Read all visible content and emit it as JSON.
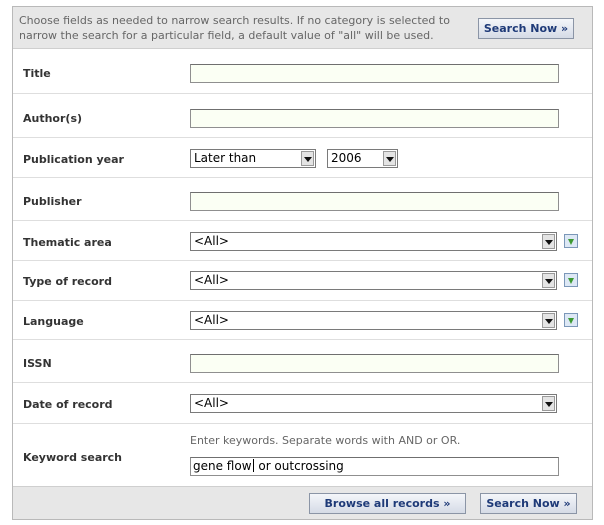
{
  "info_text": "Choose fields as needed to narrow search results. If no category is selected to narrow the search for a particular field, a default value of \"all\" will be used.",
  "buttons": {
    "search_now": "Search Now »",
    "browse_all": "Browse all records »"
  },
  "fields": {
    "title": {
      "label": "Title",
      "value": ""
    },
    "authors": {
      "label": "Author(s)",
      "value": ""
    },
    "publication_year": {
      "label": "Publication year",
      "qualifier": "Later than",
      "year": "2006"
    },
    "publisher": {
      "label": "Publisher",
      "value": ""
    },
    "thematic_area": {
      "label": "Thematic area",
      "selected": "<All>"
    },
    "type_of_record": {
      "label": "Type of record",
      "selected": "<All>"
    },
    "language": {
      "label": "Language",
      "selected": "<All>"
    },
    "issn": {
      "label": "ISSN",
      "value": ""
    },
    "date_of_record": {
      "label": "Date of record",
      "selected": "<All>"
    },
    "keyword": {
      "label": "Keyword search",
      "hint": "Enter keywords. Separate words with AND or OR.",
      "value_before_cursor": "gene flow",
      "value_after_cursor": " or outcrossing"
    }
  },
  "icons": {
    "picker": "green-down-arrow-icon",
    "dropdown": "chevron-down-icon"
  }
}
